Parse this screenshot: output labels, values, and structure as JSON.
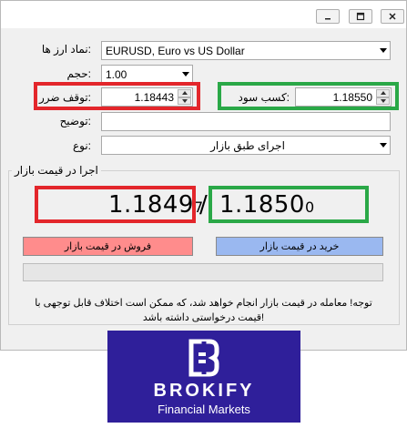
{
  "window": {
    "controls": [
      "minimize-icon",
      "restore-icon",
      "close-icon"
    ]
  },
  "form": {
    "symbol_label": ":نماد ارز ها",
    "symbol_value": "EURUSD, Euro vs US Dollar",
    "volume_label": ":حجم",
    "volume_value": "1.00",
    "stoploss_label": ":توقف ضرر",
    "stoploss_value": "1.18443",
    "takeprofit_label": ":کسب سود",
    "takeprofit_value": "1.18550",
    "comment_label": ":توضیح",
    "comment_value": "",
    "type_label": ":نوع",
    "type_value": "اجرای طبق بازار"
  },
  "market": {
    "group_title": "اجرا در قیمت بازار",
    "bid_main": "1.1849",
    "bid_small": "7",
    "separator": "/",
    "ask_main": "1.1850",
    "ask_small": "0",
    "sell_button": "فروش در قیمت بازار",
    "buy_button": "خرید در قیمت بازار",
    "notice_line1": "توجه! معامله در قیمت بازار انجام خواهد شد، که ممکن است اختلاف قابل توجهی با",
    "notice_line2": "!قیمت درخواستی داشته باشد"
  },
  "colors": {
    "sell": "#ff8c8c",
    "buy": "#9ab8f0",
    "highlight_red": "#e3262b",
    "highlight_green": "#2aa847",
    "logo_bg": "#2f1f9a"
  },
  "logo": {
    "name": "BROKIFY",
    "tagline": "Financial Markets"
  }
}
